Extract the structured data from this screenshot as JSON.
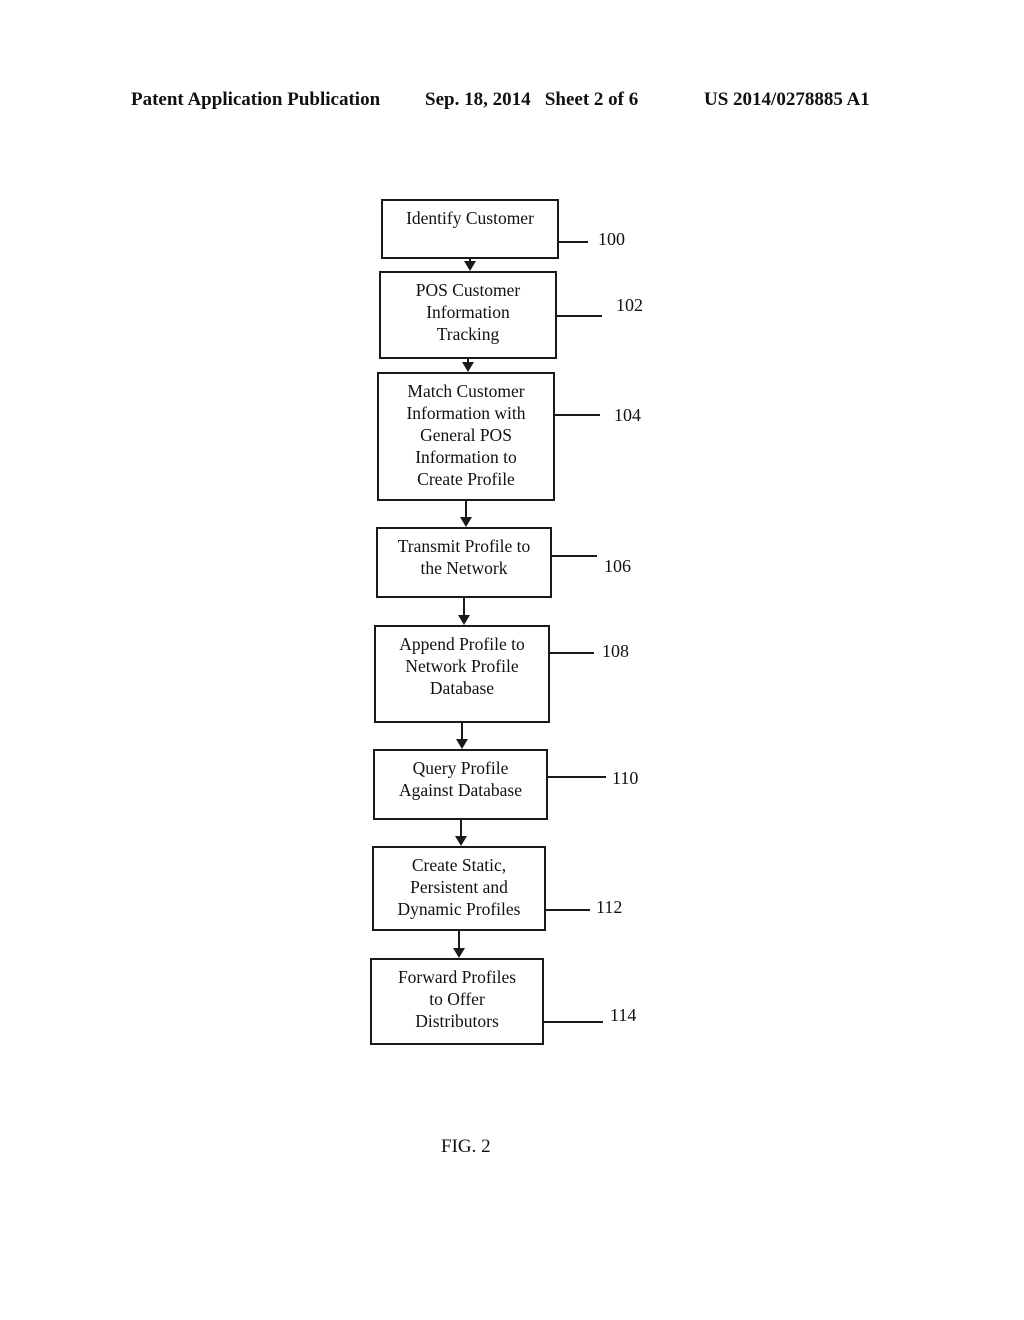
{
  "header": {
    "publication": "Patent Application Publication",
    "date_sheet": "Sep. 18, 2014   Sheet 2 of 6",
    "number": "US 2014/0278885 A1"
  },
  "flowchart": {
    "steps": [
      {
        "ref": "100",
        "lines": [
          "Identify Customer"
        ]
      },
      {
        "ref": "102",
        "lines": [
          "POS Customer",
          "Information",
          "Tracking"
        ]
      },
      {
        "ref": "104",
        "lines": [
          "Match Customer",
          "Information with",
          "General POS",
          "Information to",
          "Create Profile"
        ]
      },
      {
        "ref": "106",
        "lines": [
          "Transmit Profile to",
          "the Network"
        ]
      },
      {
        "ref": "108",
        "lines": [
          "Append Profile to",
          "Network Profile",
          "Database"
        ]
      },
      {
        "ref": "110",
        "lines": [
          "Query Profile",
          "Against Database"
        ]
      },
      {
        "ref": "112",
        "lines": [
          "Create Static,",
          "Persistent and",
          "Dynamic Profiles"
        ]
      },
      {
        "ref": "114",
        "lines": [
          "Forward Profiles",
          "to Offer",
          "Distributors"
        ]
      }
    ]
  },
  "figure_label": "FIG. 2"
}
